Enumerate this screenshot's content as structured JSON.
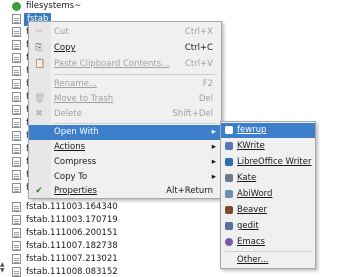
{
  "file_list": {
    "rows": [
      {
        "name": "filesystems~",
        "type": "folder",
        "selected": false
      },
      {
        "name": "fstab",
        "type": "file",
        "selected": true
      },
      {
        "name": "fsta",
        "type": "file",
        "selected": false
      },
      {
        "name": "fsta",
        "type": "file",
        "selected": false
      },
      {
        "name": "fsta",
        "type": "file",
        "selected": false
      },
      {
        "name": "fsta",
        "type": "file",
        "selected": false
      },
      {
        "name": "fsta",
        "type": "file",
        "selected": false
      },
      {
        "name": "fsta",
        "type": "file",
        "selected": false
      },
      {
        "name": "fsta",
        "type": "file",
        "selected": false
      },
      {
        "name": "fsta",
        "type": "file",
        "selected": false
      },
      {
        "name": "fsta",
        "type": "file",
        "selected": false
      },
      {
        "name": "fsta",
        "type": "file",
        "selected": false
      },
      {
        "name": "fsta",
        "type": "file",
        "selected": false
      },
      {
        "name": "fsta",
        "type": "file",
        "selected": false
      },
      {
        "name": "fsta",
        "type": "file",
        "selected": false
      },
      {
        "name": "fstab.111003.164340",
        "type": "file",
        "selected": false
      },
      {
        "name": "fstab.111003.170719",
        "type": "file",
        "selected": false
      },
      {
        "name": "fstab.111006.200151",
        "type": "file",
        "selected": false
      },
      {
        "name": "fstab.111007.182738",
        "type": "file",
        "selected": false
      },
      {
        "name": "fstab.111007.213021",
        "type": "file",
        "selected": false
      },
      {
        "name": "fstab.111008.083152",
        "type": "file",
        "selected": false
      }
    ]
  },
  "context_menu": {
    "items": [
      {
        "icon": "✂",
        "label": "Cut",
        "shortcut": "Ctrl+X",
        "disabled": true
      },
      {
        "icon": "⎘",
        "label": "Copy",
        "shortcut": "Ctrl+C",
        "disabled": false
      },
      {
        "icon": "📋",
        "label": "Paste Clipboard Contents...",
        "shortcut": "Ctrl+V",
        "disabled": true
      },
      {
        "icon": "",
        "label": "Rename...",
        "shortcut": "F2",
        "disabled": true
      },
      {
        "icon": "🗑",
        "label": "Move to Trash",
        "shortcut": "Del",
        "disabled": true
      },
      {
        "icon": "✖",
        "label": "Delete",
        "shortcut": "Shift+Del",
        "disabled": true
      },
      {
        "icon": "",
        "label": "Open With",
        "shortcut": "",
        "disabled": false,
        "submenu": true,
        "active": true
      },
      {
        "icon": "",
        "label": "Actions",
        "shortcut": "",
        "disabled": false,
        "submenu": true
      },
      {
        "icon": "",
        "label": "Compress",
        "shortcut": "",
        "disabled": false,
        "submenu": true
      },
      {
        "icon": "",
        "label": "Copy To",
        "shortcut": "",
        "disabled": false,
        "submenu": true
      },
      {
        "icon": "✔",
        "label": "Properties",
        "shortcut": "Alt+Return",
        "disabled": false
      }
    ]
  },
  "open_with_submenu": {
    "items": [
      {
        "label": "fewrup",
        "icon_color": "#3b7bc4"
      },
      {
        "label": "KWrite",
        "icon_color": "#5a78b8"
      },
      {
        "label": "LibreOffice Writer",
        "icon_color": "#2f6db5"
      },
      {
        "label": "Kate",
        "icon_color": "#6a7a8a"
      },
      {
        "label": "AbiWord",
        "icon_color": "#6e8fb0"
      },
      {
        "label": "Beaver",
        "icon_color": "#7b4a2a"
      },
      {
        "label": "gedit",
        "icon_color": "#5a6f9a"
      },
      {
        "label": "Emacs",
        "icon_color": "#7a59a8"
      },
      {
        "label": "Other...",
        "icon_color": ""
      }
    ]
  },
  "colors": {
    "selection": "#3b7bc4",
    "menu_highlight": "#3d7fcb"
  }
}
